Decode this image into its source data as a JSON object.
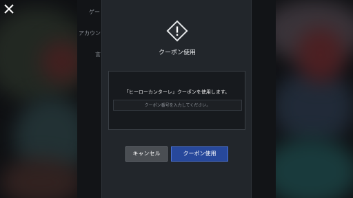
{
  "background": {
    "settings_items": [
      "ゲー",
      "アカウン",
      "言"
    ]
  },
  "modal": {
    "title": "クーポン使用",
    "message": "「ヒーローカンターレ」クーポンを使用します。",
    "input": {
      "value": "",
      "placeholder": "クーポン番号を入力してください。"
    },
    "buttons": {
      "cancel_label": "キャンセル",
      "use_label": "クーポン使用"
    }
  },
  "colors": {
    "modal_bg": "#22262b",
    "accent": "#27489b",
    "cancel": "#4a4e53"
  },
  "icons": {
    "close": "close-icon",
    "warning": "warning-icon"
  }
}
